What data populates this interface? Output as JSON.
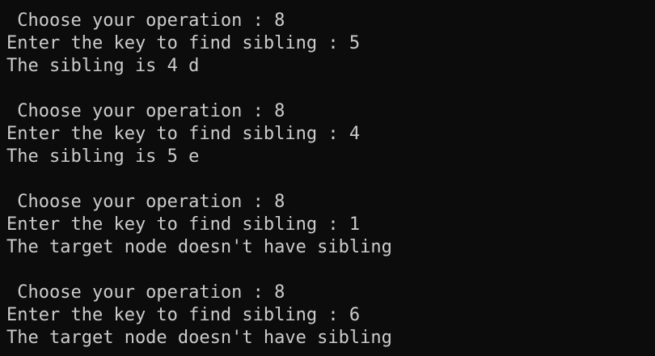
{
  "terminal": {
    "colors": {
      "background": "#0c0c0c",
      "text": "#cccccc"
    },
    "blocks": [
      {
        "prompt": " Choose your operation : 8",
        "input": "Enter the key to find sibling : 5",
        "result": "The sibling is 4 d"
      },
      {
        "prompt": " Choose your operation : 8",
        "input": "Enter the key to find sibling : 4",
        "result": "The sibling is 5 e"
      },
      {
        "prompt": " Choose your operation : 8",
        "input": "Enter the key to find sibling : 1",
        "result": "The target node doesn't have sibling"
      },
      {
        "prompt": " Choose your operation : 8",
        "input": "Enter the key to find sibling : 6",
        "result": "The target node doesn't have sibling"
      }
    ]
  }
}
